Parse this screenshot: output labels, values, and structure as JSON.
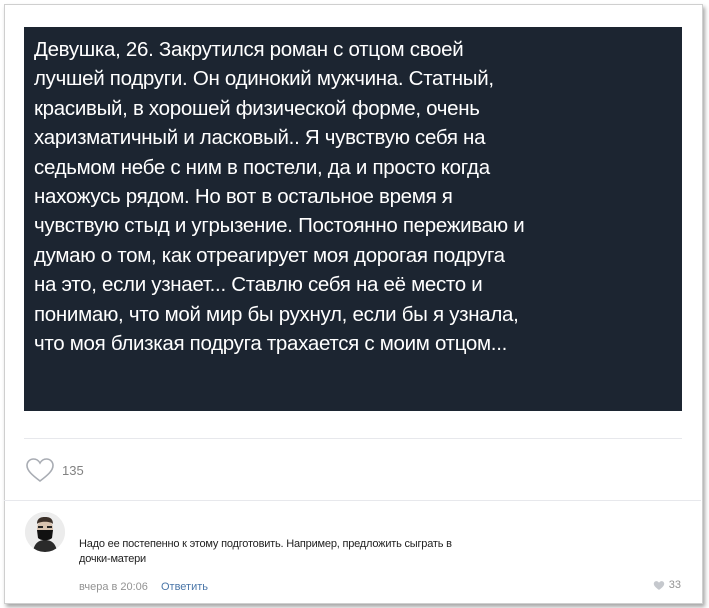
{
  "post": {
    "lines": [
      "Девушка, 26. Закрутился роман с отцом своей",
      "лучшей подруги. Он одинокий мужчина. Статный,",
      "красивый, в хорошей физической форме, очень",
      "харизматичный и ласковый.. Я чувствую себя на",
      "седьмом небе с ним в постели, да и просто когда",
      "нахожусь рядом. Но вот в остальное время я",
      "чувствую стыд и угрызение. Постоянно переживаю и",
      "думаю о том, как отреагирует моя дорогая подруга",
      "на это, если узнает... Ставлю себя на её место и",
      "понимаю, что мой мир бы рухнул, если бы я узнала,",
      "что моя близкая подруга трахается с моим отцом..."
    ],
    "likes": "135",
    "like_icon": "heart-outline-icon"
  },
  "comment": {
    "lines": [
      "Надо ее постепенно к этому подготовить. Например, предложить сыграть в",
      "дочки-матери"
    ],
    "time": "вчера в 20:06",
    "reply_label": "Ответить",
    "likes": "33",
    "avatar": "avatar-masked-man"
  },
  "colors": {
    "card_bg": "#1c2531",
    "link": "#4a76a8",
    "muted": "#939393"
  }
}
